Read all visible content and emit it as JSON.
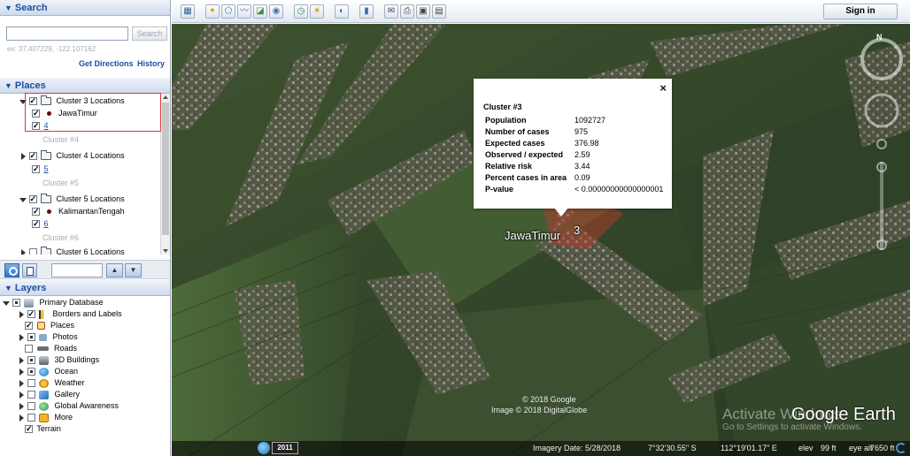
{
  "search": {
    "header": "Search",
    "input_value": "",
    "button_label": "Search",
    "hint": "ex: 37.407229, -122.107162",
    "get_directions": "Get Directions",
    "history": "History"
  },
  "places": {
    "header": "Places",
    "items": {
      "cluster3_folder": "Cluster 3 Locations",
      "cluster3_place": "JawaTimur",
      "cluster3_num": "4",
      "cluster4_desc": "Cluster #4",
      "cluster4_folder": "Cluster 4 Locations",
      "cluster4_num": "5",
      "cluster5_desc": "Cluster #5",
      "cluster5_folder": "Cluster 5 Locations",
      "cluster5_place": "KalimantanTengah",
      "cluster5_num": "6",
      "cluster6_desc": "Cluster #6",
      "cluster6_folder": "Cluster 6 Locations"
    }
  },
  "layers": {
    "header": "Layers",
    "items": [
      {
        "label": "Primary Database",
        "icon": "database-icon"
      },
      {
        "label": "Borders and Labels",
        "icon": "flag-icon"
      },
      {
        "label": "Places",
        "icon": "places-icon"
      },
      {
        "label": "Photos",
        "icon": "photo-icon"
      },
      {
        "label": "Roads",
        "icon": "road-icon"
      },
      {
        "label": "3D Buildings",
        "icon": "building-icon"
      },
      {
        "label": "Ocean",
        "icon": "ocean-icon"
      },
      {
        "label": "Weather",
        "icon": "weather-icon"
      },
      {
        "label": "Gallery",
        "icon": "gallery-icon"
      },
      {
        "label": "Global Awareness",
        "icon": "globe-icon"
      },
      {
        "label": "More",
        "icon": "more-icon"
      },
      {
        "label": "Terrain",
        "icon": "terrain-icon"
      }
    ]
  },
  "toolbar": {
    "sign_in": "Sign in"
  },
  "balloon": {
    "close": "×",
    "title": "Cluster #3",
    "rows": [
      {
        "key": "Population",
        "value": "1092727"
      },
      {
        "key": "Number of cases",
        "value": "975"
      },
      {
        "key": "Expected cases",
        "value": "376.98"
      },
      {
        "key": "Observed / expected",
        "value": "2.59"
      },
      {
        "key": "Relative risk",
        "value": "3.44"
      },
      {
        "key": "Percent cases in area",
        "value": "0.09"
      },
      {
        "key": "P-value",
        "value": "< 0.00000000000000001"
      }
    ]
  },
  "map": {
    "place_label": "JawaTimur",
    "place_number": "3",
    "copyright_1": "© 2018 Google",
    "copyright_2": "Image © 2018 DigitalGlobe",
    "activate_1": "Activate Windows",
    "activate_2": "Go to Settings to activate Windows.",
    "logo": "Google Earth"
  },
  "status": {
    "year": "2011",
    "imagery_date": "Imagery Date: 5/28/2018",
    "lat": "7°32'30.55\" S",
    "lon": "112°19'01.17\" E",
    "elev_label": "elev",
    "elev_value": "99 ft",
    "eye_alt_label": "eye alt",
    "eye_alt_value": "7650 ft"
  },
  "colors": {
    "panel_header_text": "#1d4fa1",
    "highlight_box": "#e0353c",
    "cluster_polygon": "#c0392b"
  }
}
